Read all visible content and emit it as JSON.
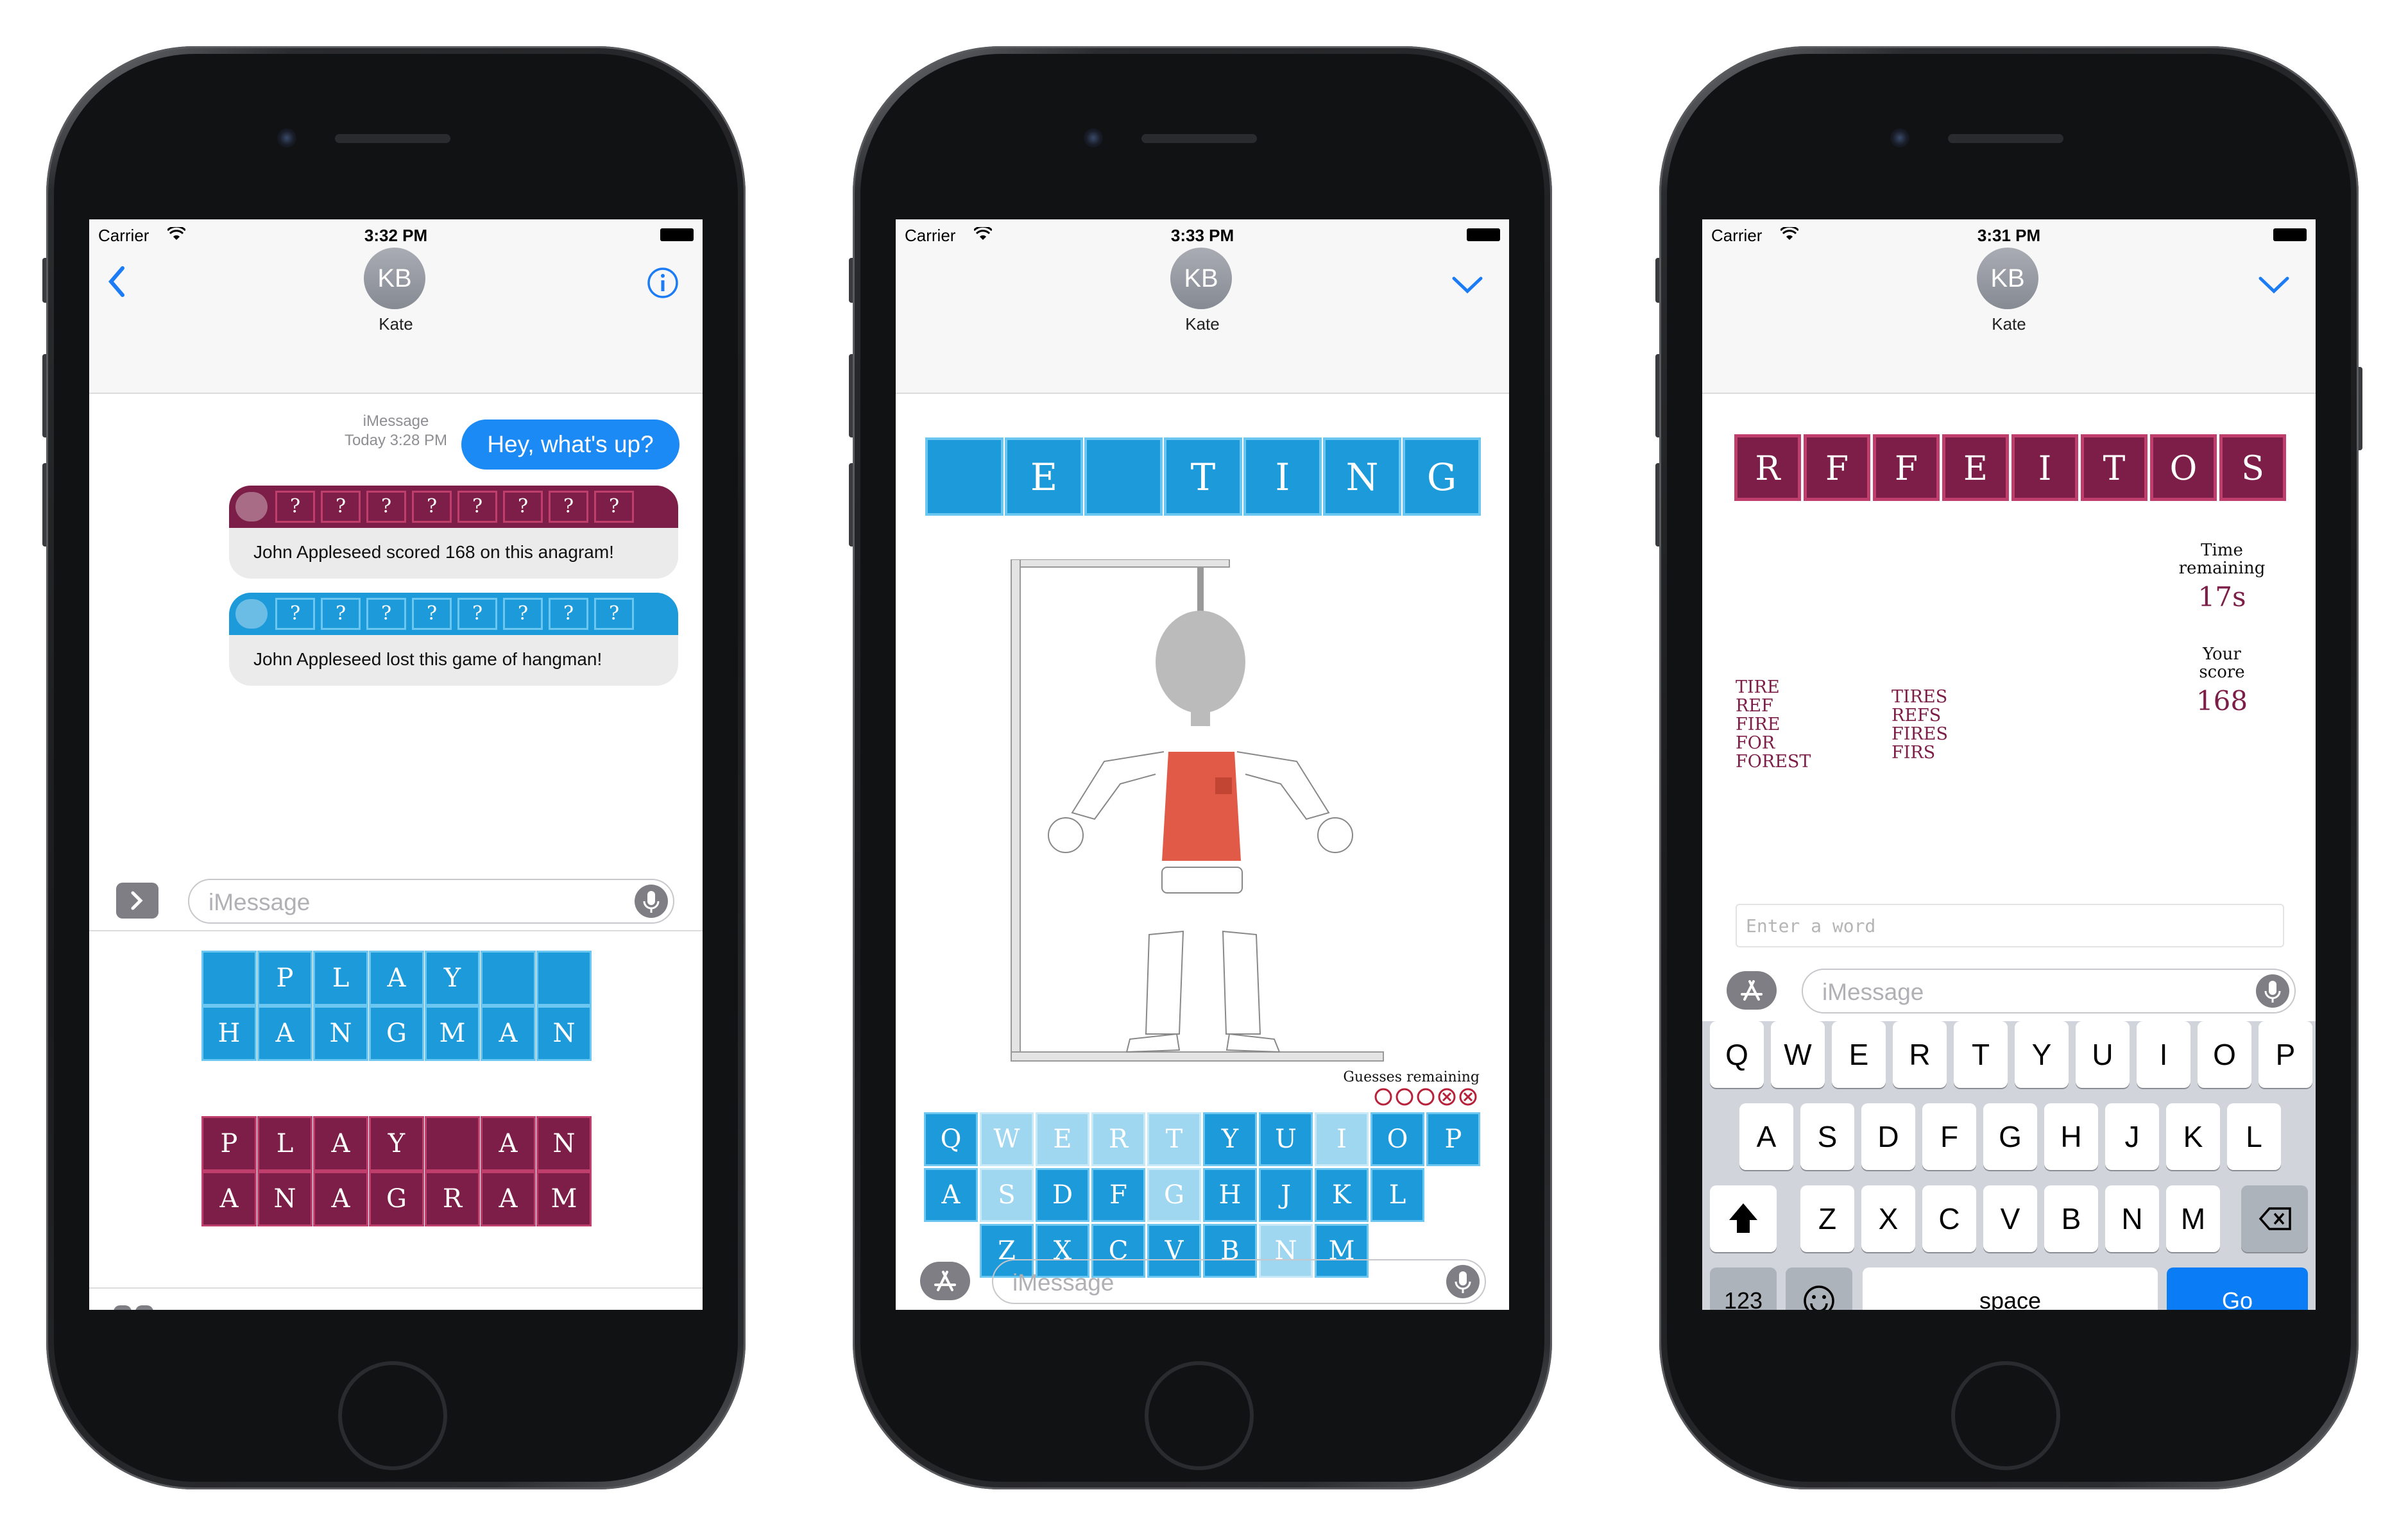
{
  "phones": [
    {
      "status": {
        "carrier": "Carrier",
        "time": "3:32 PM"
      },
      "contact": {
        "initials": "KB",
        "name": "Kate"
      },
      "meta": {
        "service": "iMessage",
        "date": "Today 3:28 PM"
      },
      "bubble": "Hey, what's up?",
      "cards": [
        {
          "tiles": [
            "?",
            "?",
            "?",
            "?",
            "?",
            "?",
            "?",
            "?"
          ],
          "caption": "John Appleseed scored 168 on this anagram!",
          "color": "#7c1e47"
        },
        {
          "tiles": [
            "?",
            "?",
            "?",
            "?",
            "?",
            "?",
            "?",
            "?"
          ],
          "caption": "John Appleseed lost this game of hangman!",
          "color": "#1d9ad9"
        }
      ],
      "input_placeholder": "iMessage",
      "stickers": {
        "hangman": [
          [
            "",
            "P",
            "L",
            "A",
            "Y",
            "",
            ""
          ],
          [
            "H",
            "A",
            "N",
            "G",
            "M",
            "A",
            "N"
          ]
        ],
        "anagram": [
          [
            "P",
            "L",
            "A",
            "Y",
            "",
            "A",
            "N"
          ],
          [
            "A",
            "N",
            "A",
            "G",
            "R",
            "A",
            "M"
          ]
        ]
      }
    },
    {
      "status": {
        "carrier": "Carrier",
        "time": "3:33 PM"
      },
      "contact": {
        "initials": "KB",
        "name": "Kate"
      },
      "word": [
        "",
        "E",
        "",
        "T",
        "I",
        "N",
        "G"
      ],
      "guesses_label": "Guesses  remaining",
      "guesses": {
        "total": 5,
        "used": 2
      },
      "keyboard": [
        [
          "Q",
          "W",
          "E",
          "R",
          "T",
          "Y",
          "U",
          "I",
          "O",
          "P"
        ],
        [
          "A",
          "S",
          "D",
          "F",
          "G",
          "H",
          "J",
          "K",
          "L"
        ],
        [
          "Z",
          "X",
          "C",
          "V",
          "B",
          "N",
          "M"
        ]
      ],
      "used_keys": [
        "W",
        "E",
        "R",
        "T",
        "I",
        "S",
        "G",
        "N"
      ],
      "input_placeholder": "iMessage"
    },
    {
      "status": {
        "carrier": "Carrier",
        "time": "3:31 PM"
      },
      "contact": {
        "initials": "KB",
        "name": "Kate"
      },
      "letters": [
        "R",
        "F",
        "F",
        "E",
        "I",
        "T",
        "O",
        "S"
      ],
      "time_label": "Time remaining",
      "time_value": "17s",
      "score_label": "Your score",
      "score_value": "168",
      "words_col1": [
        "TIRE",
        "REF",
        "FIRE",
        "FOR",
        "FOREST"
      ],
      "words_col2": [
        "TIRES",
        "REFS",
        "FIRES",
        "FIRS"
      ],
      "entry_placeholder": "Enter a word",
      "input_placeholder": "iMessage",
      "keyboard": {
        "row1": [
          "Q",
          "W",
          "E",
          "R",
          "T",
          "Y",
          "U",
          "I",
          "O",
          "P"
        ],
        "row2": [
          "A",
          "S",
          "D",
          "F",
          "G",
          "H",
          "J",
          "K",
          "L"
        ],
        "row3": [
          "Z",
          "X",
          "C",
          "V",
          "B",
          "N",
          "M"
        ],
        "numbers": "123",
        "space": "space",
        "go": "Go"
      }
    }
  ]
}
